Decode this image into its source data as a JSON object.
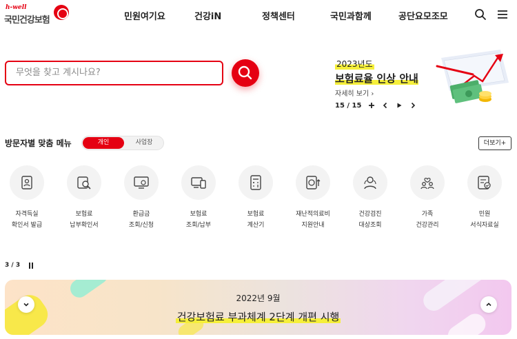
{
  "header": {
    "logo_sub": "h-well",
    "logo_name": "국민건강보험",
    "nav": [
      "민원여기요",
      "건강iN",
      "정책센터",
      "국민과함께",
      "공단요모조모"
    ]
  },
  "search": {
    "placeholder": "무엇을 찾고 계시나요?"
  },
  "promo": {
    "year": "2023년도",
    "title": "보험료율 인상 안내",
    "link": "자세히 보기",
    "page": "15 / 15"
  },
  "visitor_menu": {
    "title": "방문자별 맞춤 메뉴",
    "toggle_on": "개인",
    "toggle_off": "사업장",
    "more": "더보기+",
    "items": [
      {
        "label": "자격득실\n확인서 발급",
        "icon": "id-card-icon"
      },
      {
        "label": "보험료\n납부확인서",
        "icon": "document-search-icon"
      },
      {
        "label": "환급금\n조회/신청",
        "icon": "monitor-won-icon"
      },
      {
        "label": "보험료\n조회/납부",
        "icon": "devices-icon"
      },
      {
        "label": "보험료\n계산기",
        "icon": "calculator-icon"
      },
      {
        "label": "재난적의료비\n지원안내",
        "icon": "won-support-icon"
      },
      {
        "label": "건강검진\n대상조회",
        "icon": "person-search-icon"
      },
      {
        "label": "가족\n건강관리",
        "icon": "family-icon"
      },
      {
        "label": "민원\n서식자료실",
        "icon": "form-check-icon"
      }
    ]
  },
  "pager": {
    "text": "3 / 3"
  },
  "banner": {
    "date": "2022년 9월",
    "title": "건강보험료 부과체계 2단계 개편 시행"
  },
  "colors": {
    "brand": "#e50012",
    "highlight": "#f5ef3a"
  }
}
